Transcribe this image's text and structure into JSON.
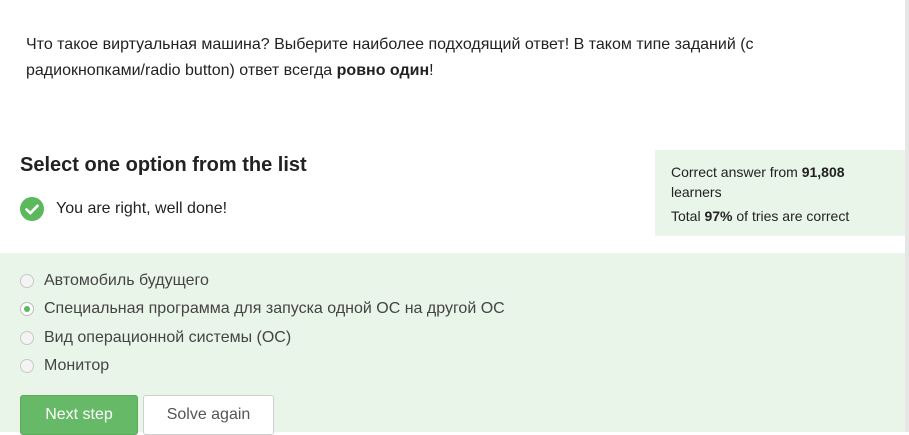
{
  "question": {
    "text_before": "Что такое виртуальная машина? Выберите наиболее подходящий ответ! В таком типе заданий (с радиокнопками/radio button) ответ всегда ",
    "bold": "ровно один",
    "text_after": "!"
  },
  "heading": "Select one option from the list",
  "feedback": {
    "icon": "check-circle-icon",
    "text": "You are right, well done!"
  },
  "stats": {
    "correct_prefix": "Correct answer from ",
    "learners_count": "91,808",
    "learners_suffix": "learners",
    "total_prefix": "Total ",
    "percent": "97%",
    "total_suffix": " of tries are correct"
  },
  "options": [
    {
      "label": "Автомобиль будущего",
      "selected": false
    },
    {
      "label": "Специальная программа для запуска одной ОС на другой ОС",
      "selected": true
    },
    {
      "label": "Вид операционной системы (ОС)",
      "selected": false
    },
    {
      "label": "Монитор",
      "selected": false
    }
  ],
  "buttons": {
    "next_step": "Next step",
    "solve_again": "Solve again"
  },
  "colors": {
    "accent_green": "#66b966",
    "panel_green": "#e9f5e9",
    "check_green": "#5cb85c"
  }
}
